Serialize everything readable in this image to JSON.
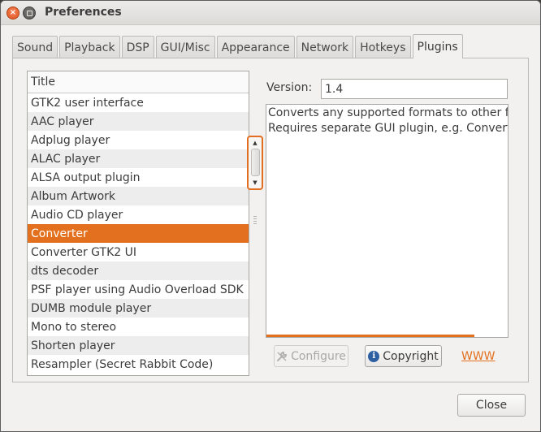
{
  "window": {
    "title": "Preferences",
    "close_glyph": "×"
  },
  "tabs": [
    {
      "label": "Sound"
    },
    {
      "label": "Playback"
    },
    {
      "label": "DSP"
    },
    {
      "label": "GUI/Misc"
    },
    {
      "label": "Appearance"
    },
    {
      "label": "Network"
    },
    {
      "label": "Hotkeys"
    },
    {
      "label": "Plugins",
      "active": true
    }
  ],
  "plugins": {
    "column_header": "Title",
    "items": [
      "GTK2 user interface",
      "AAC player",
      "Adplug player",
      "ALAC player",
      "ALSA output plugin",
      "Album Artwork",
      "Audio CD player",
      "Converter",
      "Converter GTK2 UI",
      "dts decoder",
      "PSF player using Audio Overload SDK",
      "DUMB module player",
      "Mono to stereo",
      "Shorten player",
      "Resampler (Secret Rabbit Code)"
    ],
    "selected": "Converter"
  },
  "details": {
    "version_label": "Version:",
    "version_value": "1.4",
    "description_lines": [
      "Converts any supported formats to other for",
      "Requires separate GUI plugin, e.g. Converter"
    ]
  },
  "buttons": {
    "configure": "Configure",
    "copyright": "Copyright",
    "www": "WWW",
    "close": "Close"
  },
  "colors": {
    "accent": "#e2701e",
    "selection_text": "#ffffff",
    "window_bg": "#f2f1f0"
  }
}
